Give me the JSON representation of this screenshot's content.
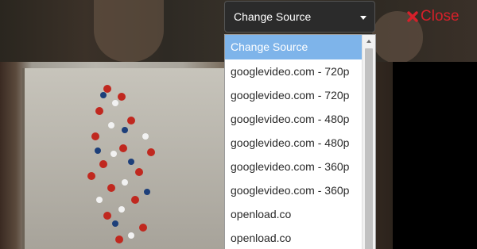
{
  "header": {
    "select_label": "Change Source",
    "close_label": "Close"
  },
  "dropdown": {
    "options": [
      "Change Source",
      "googlevideo.com - 720p",
      "googlevideo.com - 720p",
      "googlevideo.com - 480p",
      "googlevideo.com - 480p",
      "googlevideo.com - 360p",
      "googlevideo.com - 360p",
      "openload.co",
      "openload.co"
    ],
    "selected_index": 0
  },
  "colors": {
    "close": "#d6202a",
    "selected_option_bg": "#7eb4ea",
    "select_bg": "#2b2b2b"
  },
  "icons": {
    "close": "x-icon",
    "select_caret": "caret-down-icon",
    "scroll_up": "scroll-up-arrow-icon"
  }
}
